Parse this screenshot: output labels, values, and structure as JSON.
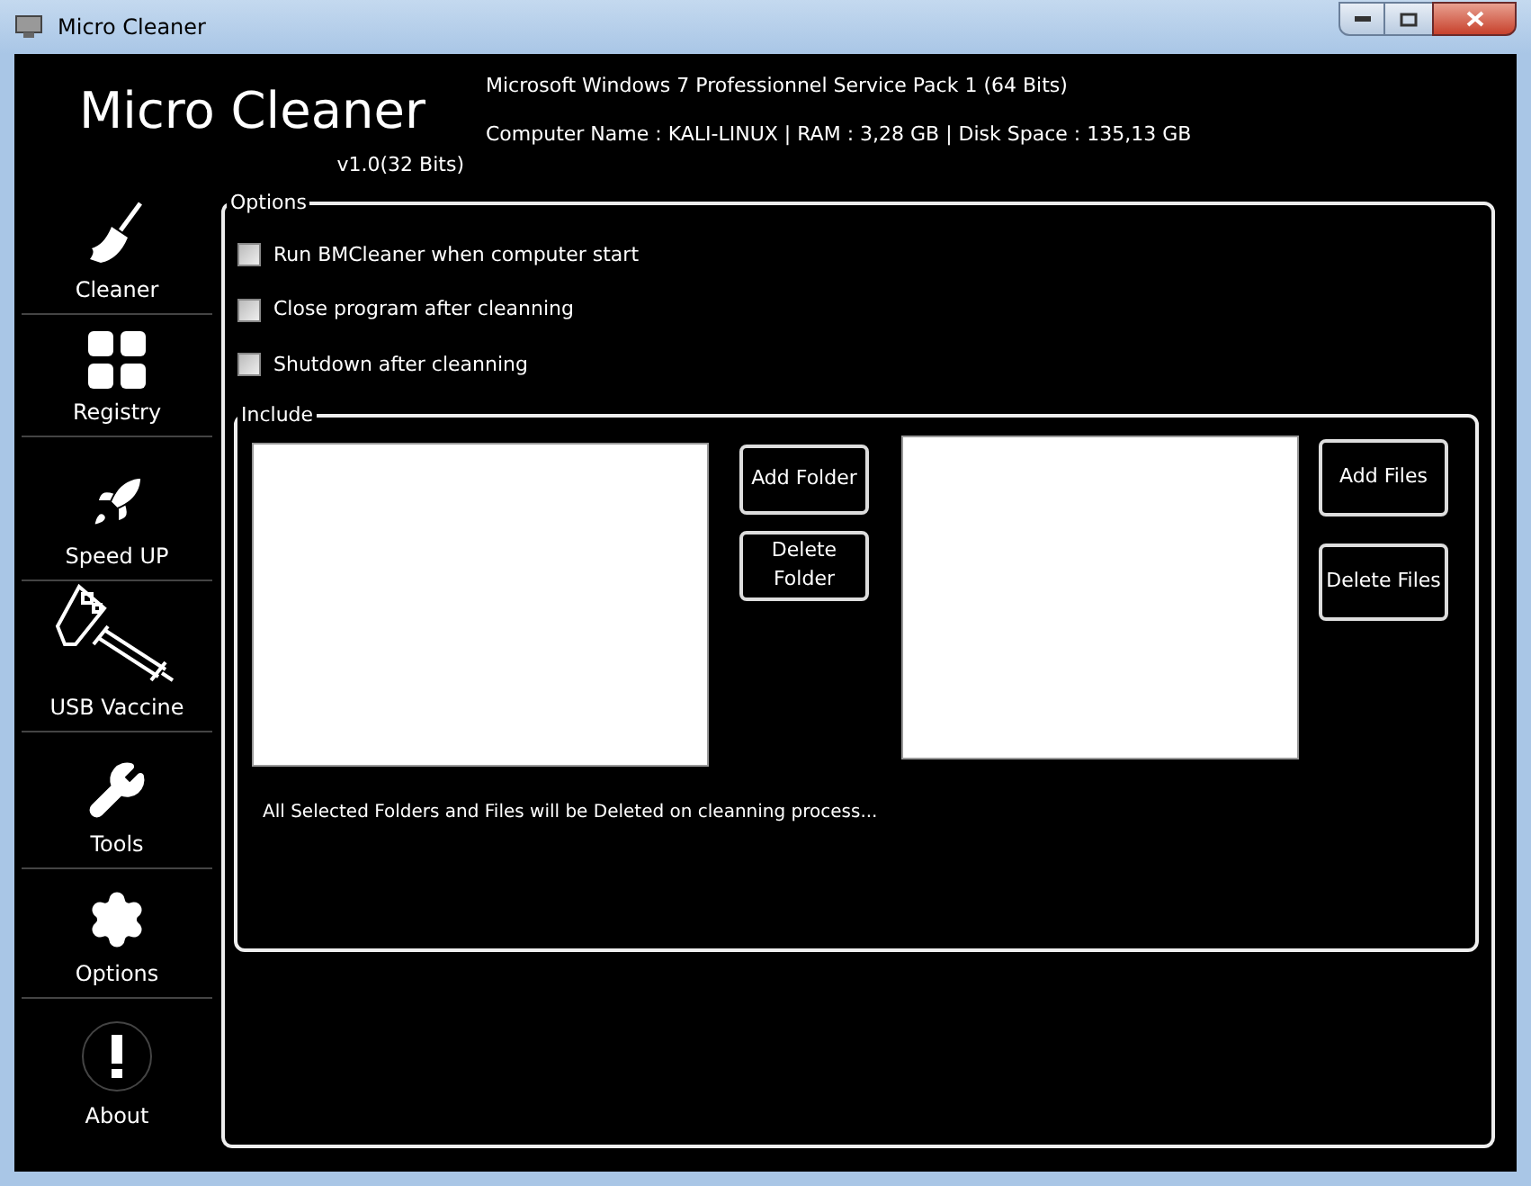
{
  "window": {
    "title": "Micro Cleaner"
  },
  "header": {
    "app_name": "Micro Cleaner",
    "version": "v1.0(32 Bits)",
    "os_info": "Microsoft Windows 7 Professionnel  Service Pack 1 (64 Bits)",
    "system_info": "Computer Name : KALI-LINUX | RAM : 3,28 GB | Disk Space : 135,13 GB"
  },
  "sidebar": {
    "items": [
      {
        "kind": "broom",
        "label": "Cleaner"
      },
      {
        "kind": "grid",
        "label": "Registry"
      },
      {
        "kind": "rocket",
        "label": "Speed UP"
      },
      {
        "kind": "usb",
        "label": "USB Vaccine"
      },
      {
        "kind": "wrench",
        "label": "Tools"
      },
      {
        "kind": "gear",
        "label": "Options"
      },
      {
        "kind": "about",
        "label": "About"
      }
    ]
  },
  "options": {
    "legend": "Options",
    "checkboxes": [
      {
        "label": "Run BMCleaner when computer start",
        "checked": false
      },
      {
        "label": "Close program after cleanning",
        "checked": false
      },
      {
        "label": "Shutdown after cleanning",
        "checked": false
      }
    ]
  },
  "include": {
    "legend": "Include",
    "folder_buttons": [
      "Add Folder",
      "Delete Folder"
    ],
    "file_buttons": [
      "Add Files",
      "Delete Files"
    ],
    "note": "All Selected Folders and Files will be Deleted on cleanning process..."
  }
}
